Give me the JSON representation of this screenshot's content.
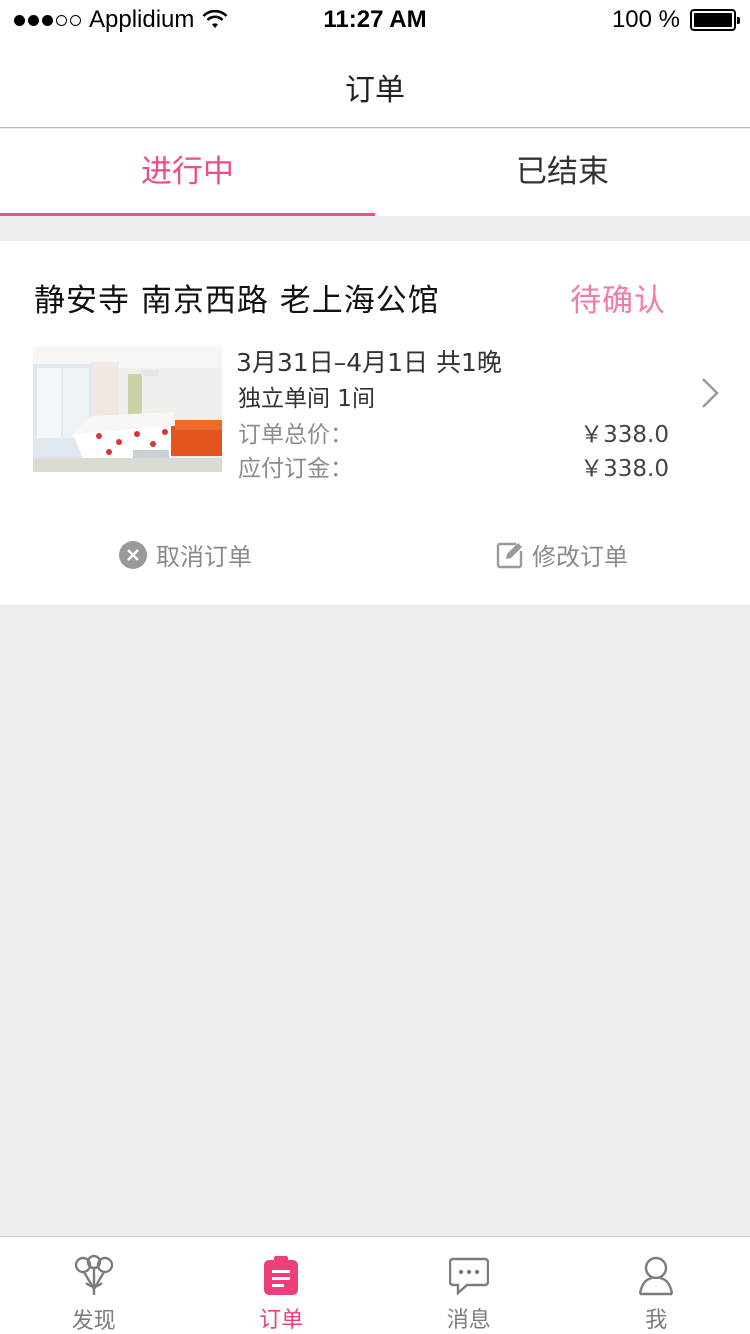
{
  "status_bar": {
    "carrier": "Applidium",
    "time": "11:27 AM",
    "battery": "100 %"
  },
  "nav": {
    "title": "订单"
  },
  "tabs": [
    {
      "label": "进行中",
      "active": true
    },
    {
      "label": "已结束",
      "active": false
    }
  ],
  "order": {
    "hotel_name": "静安寺 南京西路 老上海公馆",
    "status": "待确认",
    "date_range": "3月31日–4月1日 共1晚",
    "room": "独立单间 1间",
    "total_label": "订单总价：",
    "total_value": "￥338.0",
    "deposit_label": "应付订金：",
    "deposit_value": "￥338.0",
    "cancel_label": "取消订单",
    "modify_label": "修改订单"
  },
  "tab_bar": [
    {
      "label": "发现",
      "icon": "discover-icon",
      "active": false
    },
    {
      "label": "订单",
      "icon": "orders-icon",
      "active": true
    },
    {
      "label": "消息",
      "icon": "message-icon",
      "active": false
    },
    {
      "label": "我",
      "icon": "profile-icon",
      "active": false
    }
  ],
  "colors": {
    "accent": "#ee4d88",
    "status_pink": "#f07cab",
    "background": "#ebeef0"
  }
}
